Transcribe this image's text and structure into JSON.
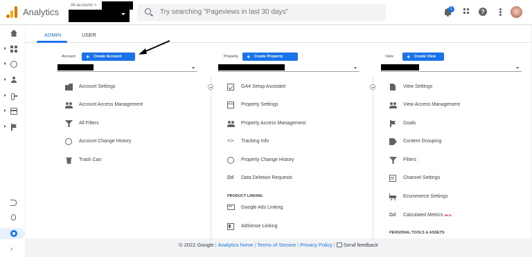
{
  "app": {
    "name": "Analytics",
    "account_path": "All accounts >"
  },
  "search": {
    "placeholder": "Try searching \"Pageviews in last 30 days\""
  },
  "topbar": {
    "notification_count": "1"
  },
  "tabs": [
    {
      "label": "ADMIN",
      "active": true
    },
    {
      "label": "USER",
      "active": false
    }
  ],
  "account": {
    "label": "Account",
    "create_label": "Create Account",
    "items": [
      "Account Settings",
      "Account Access Management",
      "All Filters",
      "Account Change History",
      "Trash Can"
    ]
  },
  "property": {
    "label": "Property",
    "create_label": "Create Property",
    "items": [
      "GA4 Setup Assistant",
      "Property Settings",
      "Property Access Management",
      "Tracking Info",
      "Property Change History",
      "Data Deletion Requests"
    ],
    "section_product_linking": "PRODUCT LINKING",
    "linking_items": [
      "Google Ads Linking",
      "AdSense Linking"
    ]
  },
  "view": {
    "label": "View",
    "create_label": "Create View",
    "items": [
      "View Settings",
      "View Access Management",
      "Goals",
      "Content Grouping",
      "Filters",
      "Channel Settings",
      "Ecommerce Settings",
      "Calculated Metrics"
    ],
    "beta_badge": "BETA",
    "section_personal": "PERSONAL TOOLS & ASSETS"
  },
  "footer": {
    "copyright": "© 2022 Google",
    "links": [
      "Analytics home",
      "Terms of Service",
      "Privacy Policy"
    ],
    "feedback": "Send feedback"
  },
  "colors": {
    "accent": "#1a73e8",
    "logo_orange": "#e37400",
    "logo_yellow": "#f9ab00"
  }
}
